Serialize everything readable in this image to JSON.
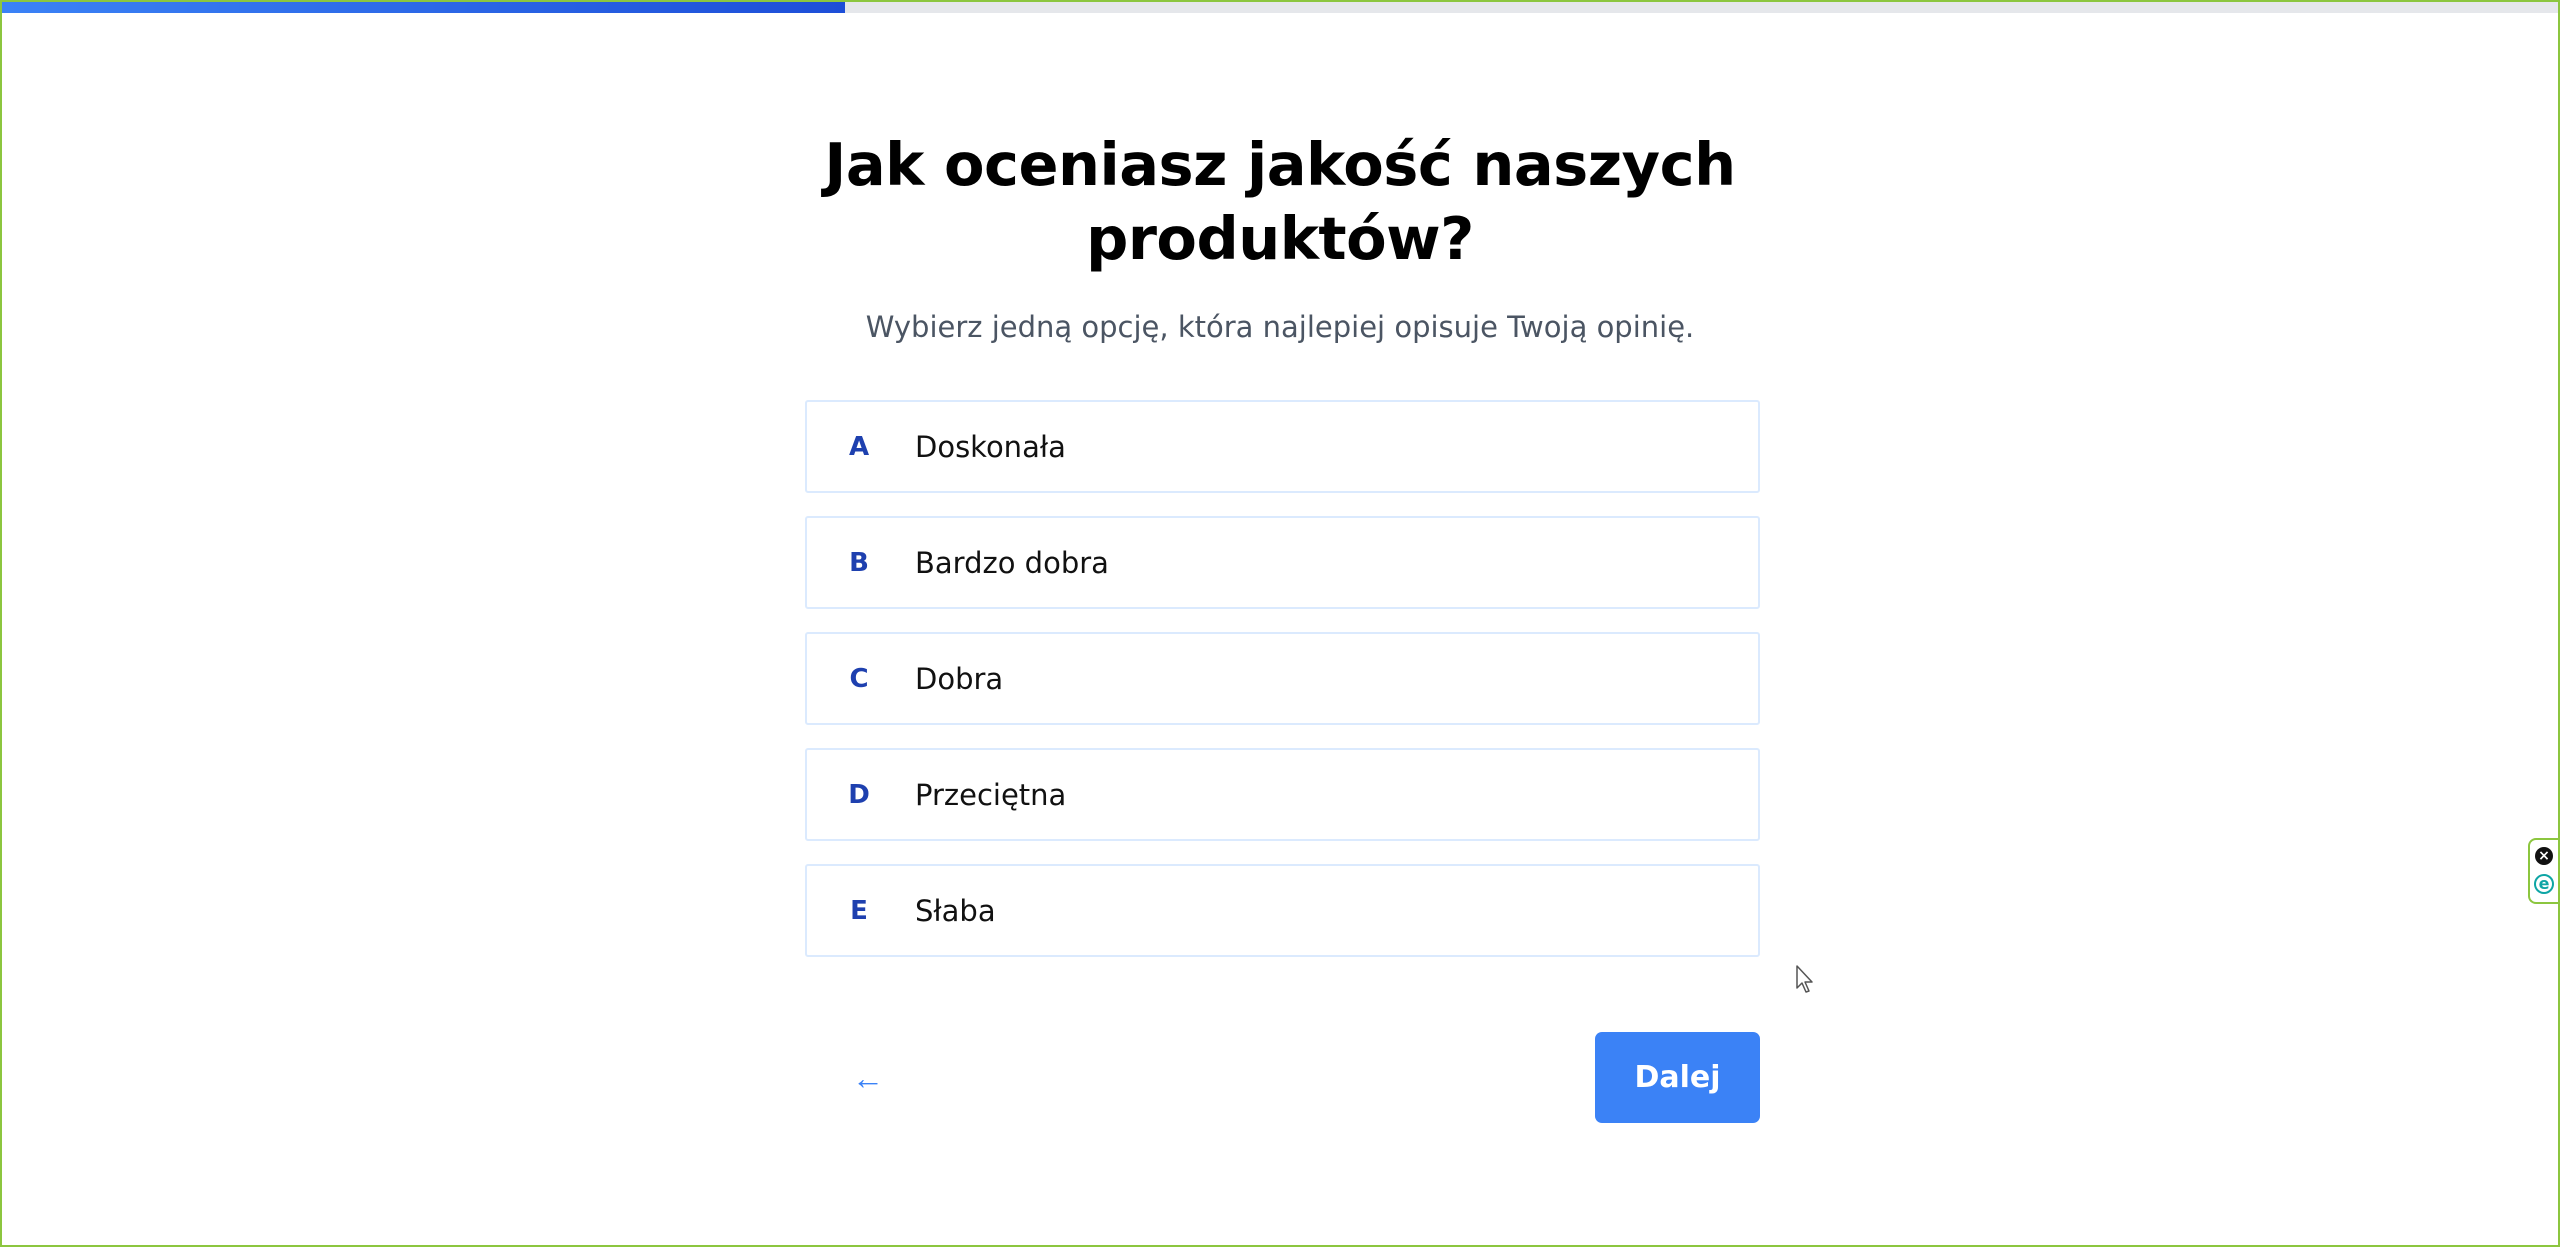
{
  "progress": {
    "fraction": 0.33
  },
  "question": {
    "title_line1": "Jak oceniasz jakość naszych",
    "title_line2": "produktów?",
    "subtitle": "Wybierz jedną opcję, która najlepiej opisuje Twoją opinię."
  },
  "options": [
    {
      "letter": "A",
      "label": "Doskonała"
    },
    {
      "letter": "B",
      "label": "Bardzo dobra"
    },
    {
      "letter": "C",
      "label": "Dobra"
    },
    {
      "letter": "D",
      "label": "Przeciętna"
    },
    {
      "letter": "E",
      "label": "Słaba"
    }
  ],
  "navigation": {
    "back_label": "←",
    "next_label": "Dalej"
  },
  "extension_widget": {
    "close_glyph": "×",
    "icon_glyph": "e"
  },
  "colors": {
    "accent": "#3b82f6",
    "letter": "#1e40af",
    "option_border": "#dbeafe",
    "frame": "#8cc63f"
  }
}
